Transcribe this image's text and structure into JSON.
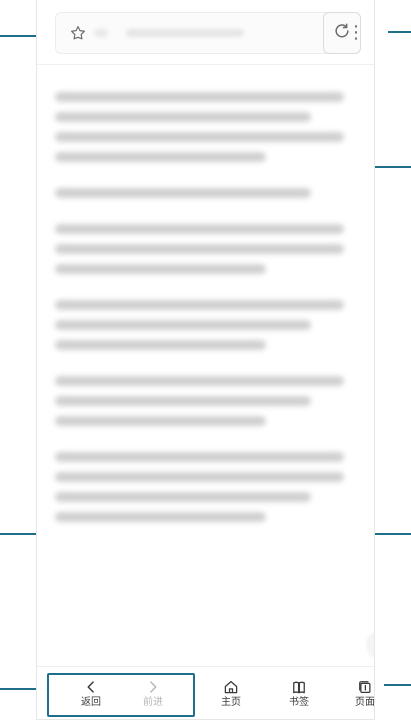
{
  "top": {
    "star_icon": "star-icon",
    "address_text": "",
    "refresh_icon": "refresh-icon",
    "more_icon": "more-vertical-icon"
  },
  "bottom": {
    "back": {
      "label": "返回",
      "icon": "chevron-left-icon"
    },
    "forward": {
      "label": "前进",
      "icon": "chevron-right-icon"
    },
    "home": {
      "label": "主页",
      "icon": "home-icon"
    },
    "bookmarks": {
      "label": "书签",
      "icon": "bookmark-icon"
    },
    "pages": {
      "label": "页面",
      "icon": "tabs-icon"
    }
  },
  "colors": {
    "accent": "#1f6f8b"
  }
}
